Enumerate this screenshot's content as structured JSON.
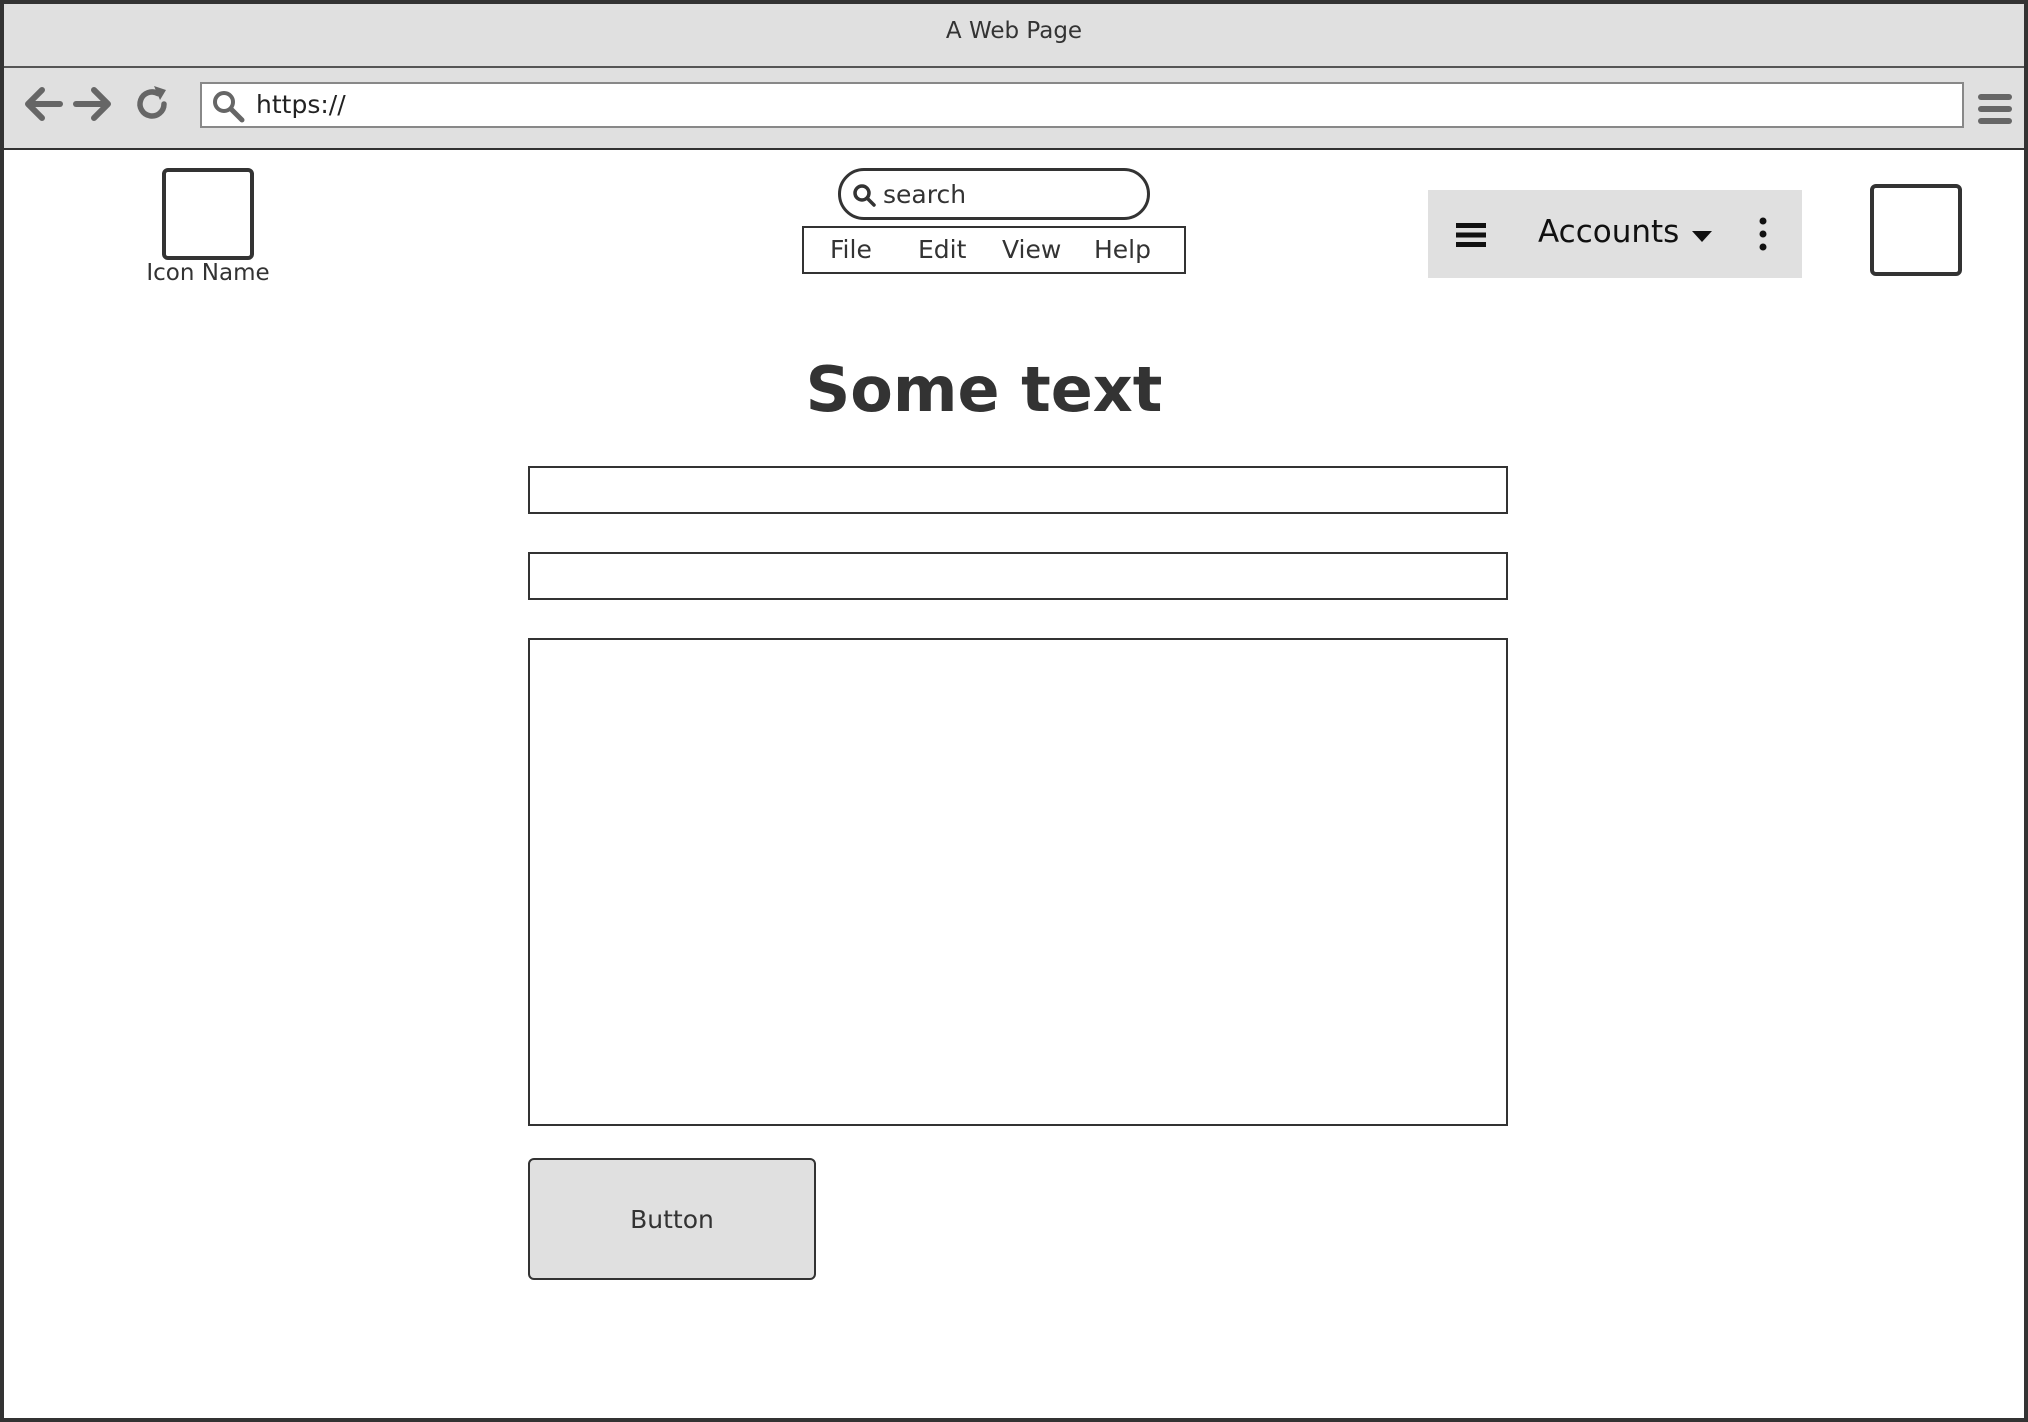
{
  "window": {
    "title": "A Web Page"
  },
  "browser": {
    "back_icon": "arrow-left-icon",
    "forward_icon": "arrow-right-icon",
    "reload_icon": "reload-icon",
    "url_icon": "search-icon",
    "url": "https://",
    "menu_icon": "hamburger-menu-icon"
  },
  "header": {
    "app_icon_label": "Icon Name",
    "search": {
      "placeholder": "search",
      "icon": "search-icon"
    },
    "menu": [
      {
        "label": "File"
      },
      {
        "label": "Edit"
      },
      {
        "label": "View"
      },
      {
        "label": "Help"
      }
    ],
    "toolbar": {
      "menu_icon": "hamburger-menu-icon",
      "accounts_label": "Accounts",
      "dropdown_icon": "caret-down-icon",
      "more_icon": "kebab-menu-icon"
    }
  },
  "main": {
    "heading": "Some text",
    "input_1_value": "",
    "input_2_value": "",
    "textarea_value": "",
    "button_label": "Button"
  },
  "colors": {
    "chrome": "#e0e0e0",
    "border": "#333333",
    "icon_gray": "#666666"
  }
}
